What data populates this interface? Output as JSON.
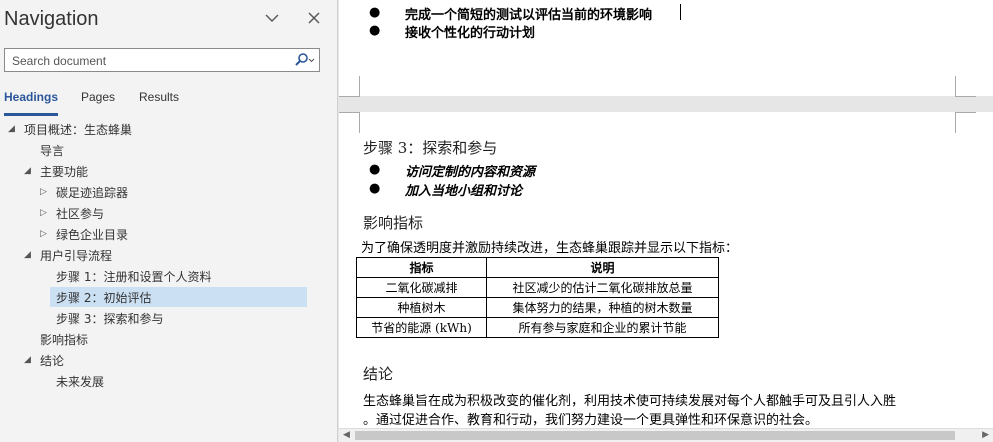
{
  "nav": {
    "title": "Navigation",
    "search_placeholder": "Search document",
    "tabs": [
      "Headings",
      "Pages",
      "Results"
    ],
    "tree": [
      {
        "label": "项目概述：生态蜂巢",
        "level": 0,
        "expander": "expanded"
      },
      {
        "label": "导言",
        "level": 1,
        "expander": "none"
      },
      {
        "label": "主要功能",
        "level": 1,
        "expander": "expanded"
      },
      {
        "label": "碳足迹追踪器",
        "level": 2,
        "expander": "collapsed"
      },
      {
        "label": "社区参与",
        "level": 2,
        "expander": "collapsed"
      },
      {
        "label": "绿色企业目录",
        "level": 2,
        "expander": "collapsed"
      },
      {
        "label": "用户引导流程",
        "level": 1,
        "expander": "expanded"
      },
      {
        "label": "步骤 1：注册和设置个人资料",
        "level": 2,
        "expander": "none"
      },
      {
        "label": "步骤 2：初始评估",
        "level": 2,
        "expander": "none",
        "selected": true
      },
      {
        "label": "步骤 3：探索和参与",
        "level": 2,
        "expander": "none"
      },
      {
        "label": "影响指标",
        "level": 1,
        "expander": "none"
      },
      {
        "label": "结论",
        "level": 1,
        "expander": "expanded"
      },
      {
        "label": "未来发展",
        "level": 2,
        "expander": "none"
      }
    ]
  },
  "doc": {
    "page1_bullets": [
      "完成一个简短的测试以评估当前的环境影响",
      "接收个性化的行动计划"
    ],
    "step3_heading": "步骤 3：探索和参与",
    "step3_bullets": [
      "访问定制的内容和资源",
      "加入当地小组和讨论"
    ],
    "metrics_heading": "影响指标",
    "metrics_intro": "为了确保透明度并激励持续改进，生态蜂巢跟踪并显示以下指标：",
    "table": {
      "headers": [
        "指标",
        "说明"
      ],
      "rows": [
        [
          "二氧化碳减排",
          "社区减少的估计二氧化碳排放总量"
        ],
        [
          "种植树木",
          "集体努力的结果，种植的树木数量"
        ],
        [
          "节省的能源 (kWh)",
          "所有参与家庭和企业的累计节能"
        ]
      ]
    },
    "conclusion_heading": "结论",
    "conclusion_line1": "生态蜂巢旨在成为积极改变的催化剂，利用技术使可持续发展对每个人都触手可及且引人入胜",
    "conclusion_line2": "。通过促进合作、教育和行动，我们努力建设一个更具弹性和环保意识的社会。"
  },
  "colors": {
    "accent": "#2b579a",
    "selection": "#cce0f4",
    "search_icon": "#2b579a"
  }
}
